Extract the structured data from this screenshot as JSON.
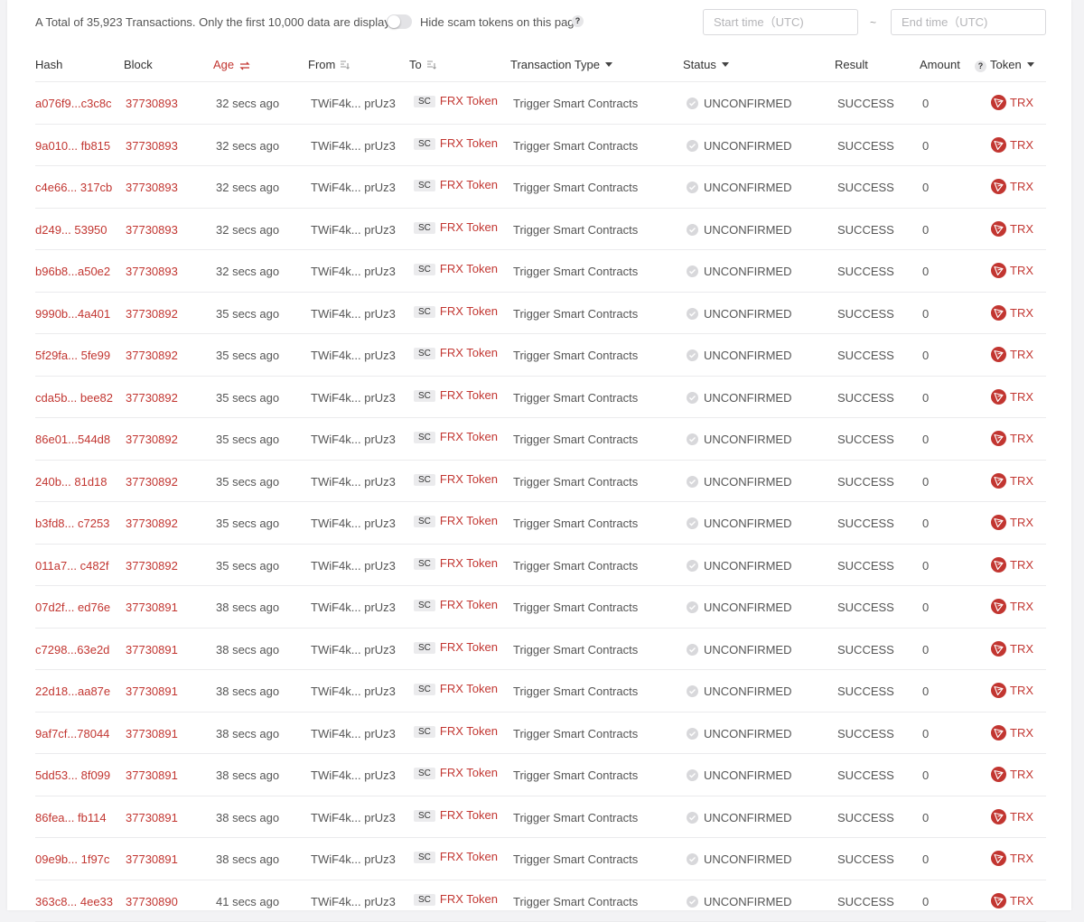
{
  "summary": "A Total of 35,923 Transactions. Only the first 10,000 data are displayed.",
  "hide_scam_label": "Hide scam tokens on this page",
  "question_mark": "?",
  "start_time_placeholder": "Start time（UTC)",
  "end_time_placeholder": "End time（UTC)",
  "tilde": "~",
  "columns": {
    "hash": "Hash",
    "block": "Block",
    "age": "Age",
    "from": "From",
    "to": "To",
    "type": "Transaction Type",
    "status": "Status",
    "result": "Result",
    "amount": "Amount",
    "token": "Token"
  },
  "colors": {
    "accent": "#c23631"
  },
  "rows": [
    {
      "hash": "a076f9...c3c8c",
      "block": "37730893",
      "age": "32 secs ago",
      "from": "TWiF4k... prUz3",
      "tag": "SC",
      "to": "FRX Token",
      "type": "Trigger Smart Contracts",
      "status": "UNCONFIRMED",
      "result": "SUCCESS",
      "amount": "0",
      "token": "TRX"
    },
    {
      "hash": "9a010... fb815",
      "block": "37730893",
      "age": "32 secs ago",
      "from": "TWiF4k... prUz3",
      "tag": "SC",
      "to": "FRX Token",
      "type": "Trigger Smart Contracts",
      "status": "UNCONFIRMED",
      "result": "SUCCESS",
      "amount": "0",
      "token": "TRX"
    },
    {
      "hash": "c4e66... 317cb",
      "block": "37730893",
      "age": "32 secs ago",
      "from": "TWiF4k... prUz3",
      "tag": "SC",
      "to": "FRX Token",
      "type": "Trigger Smart Contracts",
      "status": "UNCONFIRMED",
      "result": "SUCCESS",
      "amount": "0",
      "token": "TRX"
    },
    {
      "hash": "d249... 53950",
      "block": "37730893",
      "age": "32 secs ago",
      "from": "TWiF4k... prUz3",
      "tag": "SC",
      "to": "FRX Token",
      "type": "Trigger Smart Contracts",
      "status": "UNCONFIRMED",
      "result": "SUCCESS",
      "amount": "0",
      "token": "TRX"
    },
    {
      "hash": "b96b8...a50e2",
      "block": "37730893",
      "age": "32 secs ago",
      "from": "TWiF4k... prUz3",
      "tag": "SC",
      "to": "FRX Token",
      "type": "Trigger Smart Contracts",
      "status": "UNCONFIRMED",
      "result": "SUCCESS",
      "amount": "0",
      "token": "TRX"
    },
    {
      "hash": "9990b...4a401",
      "block": "37730892",
      "age": "35 secs ago",
      "from": "TWiF4k... prUz3",
      "tag": "SC",
      "to": "FRX Token",
      "type": "Trigger Smart Contracts",
      "status": "UNCONFIRMED",
      "result": "SUCCESS",
      "amount": "0",
      "token": "TRX"
    },
    {
      "hash": "5f29fa... 5fe99",
      "block": "37730892",
      "age": "35 secs ago",
      "from": "TWiF4k... prUz3",
      "tag": "SC",
      "to": "FRX Token",
      "type": "Trigger Smart Contracts",
      "status": "UNCONFIRMED",
      "result": "SUCCESS",
      "amount": "0",
      "token": "TRX"
    },
    {
      "hash": "cda5b... bee82",
      "block": "37730892",
      "age": "35 secs ago",
      "from": "TWiF4k... prUz3",
      "tag": "SC",
      "to": "FRX Token",
      "type": "Trigger Smart Contracts",
      "status": "UNCONFIRMED",
      "result": "SUCCESS",
      "amount": "0",
      "token": "TRX"
    },
    {
      "hash": "86e01...544d8",
      "block": "37730892",
      "age": "35 secs ago",
      "from": "TWiF4k... prUz3",
      "tag": "SC",
      "to": "FRX Token",
      "type": "Trigger Smart Contracts",
      "status": "UNCONFIRMED",
      "result": "SUCCESS",
      "amount": "0",
      "token": "TRX"
    },
    {
      "hash": "240b... 81d18",
      "block": "37730892",
      "age": "35 secs ago",
      "from": "TWiF4k... prUz3",
      "tag": "SC",
      "to": "FRX Token",
      "type": "Trigger Smart Contracts",
      "status": "UNCONFIRMED",
      "result": "SUCCESS",
      "amount": "0",
      "token": "TRX"
    },
    {
      "hash": "b3fd8... c7253",
      "block": "37730892",
      "age": "35 secs ago",
      "from": "TWiF4k... prUz3",
      "tag": "SC",
      "to": "FRX Token",
      "type": "Trigger Smart Contracts",
      "status": "UNCONFIRMED",
      "result": "SUCCESS",
      "amount": "0",
      "token": "TRX"
    },
    {
      "hash": "011a7... c482f",
      "block": "37730892",
      "age": "35 secs ago",
      "from": "TWiF4k... prUz3",
      "tag": "SC",
      "to": "FRX Token",
      "type": "Trigger Smart Contracts",
      "status": "UNCONFIRMED",
      "result": "SUCCESS",
      "amount": "0",
      "token": "TRX"
    },
    {
      "hash": "07d2f... ed76e",
      "block": "37730891",
      "age": "38 secs ago",
      "from": "TWiF4k... prUz3",
      "tag": "SC",
      "to": "FRX Token",
      "type": "Trigger Smart Contracts",
      "status": "UNCONFIRMED",
      "result": "SUCCESS",
      "amount": "0",
      "token": "TRX"
    },
    {
      "hash": "c7298...63e2d",
      "block": "37730891",
      "age": "38 secs ago",
      "from": "TWiF4k... prUz3",
      "tag": "SC",
      "to": "FRX Token",
      "type": "Trigger Smart Contracts",
      "status": "UNCONFIRMED",
      "result": "SUCCESS",
      "amount": "0",
      "token": "TRX"
    },
    {
      "hash": "22d18...aa87e",
      "block": "37730891",
      "age": "38 secs ago",
      "from": "TWiF4k... prUz3",
      "tag": "SC",
      "to": "FRX Token",
      "type": "Trigger Smart Contracts",
      "status": "UNCONFIRMED",
      "result": "SUCCESS",
      "amount": "0",
      "token": "TRX"
    },
    {
      "hash": "9af7cf...78044",
      "block": "37730891",
      "age": "38 secs ago",
      "from": "TWiF4k... prUz3",
      "tag": "SC",
      "to": "FRX Token",
      "type": "Trigger Smart Contracts",
      "status": "UNCONFIRMED",
      "result": "SUCCESS",
      "amount": "0",
      "token": "TRX"
    },
    {
      "hash": "5dd53... 8f099",
      "block": "37730891",
      "age": "38 secs ago",
      "from": "TWiF4k... prUz3",
      "tag": "SC",
      "to": "FRX Token",
      "type": "Trigger Smart Contracts",
      "status": "UNCONFIRMED",
      "result": "SUCCESS",
      "amount": "0",
      "token": "TRX"
    },
    {
      "hash": "86fea... fb114",
      "block": "37730891",
      "age": "38 secs ago",
      "from": "TWiF4k... prUz3",
      "tag": "SC",
      "to": "FRX Token",
      "type": "Trigger Smart Contracts",
      "status": "UNCONFIRMED",
      "result": "SUCCESS",
      "amount": "0",
      "token": "TRX"
    },
    {
      "hash": "09e9b... 1f97c",
      "block": "37730891",
      "age": "38 secs ago",
      "from": "TWiF4k... prUz3",
      "tag": "SC",
      "to": "FRX Token",
      "type": "Trigger Smart Contracts",
      "status": "UNCONFIRMED",
      "result": "SUCCESS",
      "amount": "0",
      "token": "TRX"
    },
    {
      "hash": "363c8... 4ee33",
      "block": "37730890",
      "age": "41 secs ago",
      "from": "TWiF4k... prUz3",
      "tag": "SC",
      "to": "FRX Token",
      "type": "Trigger Smart Contracts",
      "status": "UNCONFIRMED",
      "result": "SUCCESS",
      "amount": "0",
      "token": "TRX"
    }
  ]
}
